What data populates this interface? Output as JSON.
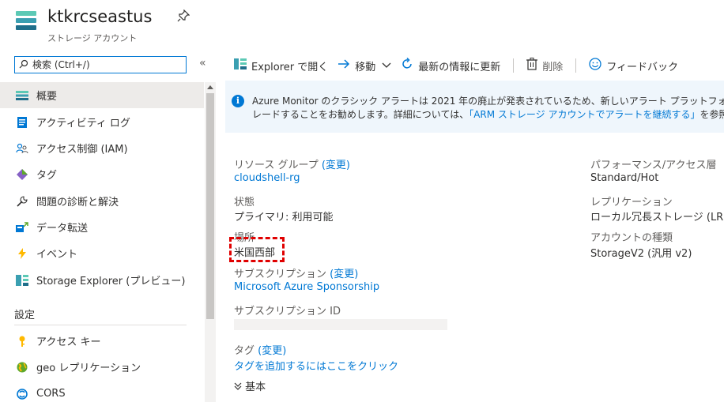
{
  "header": {
    "title": "ktkrcseastus",
    "subtitle": "ストレージ アカウント",
    "pin_icon": "pin-icon",
    "resource_icon": "storage-account-icon"
  },
  "search": {
    "placeholder": "検索 (Ctrl+/)",
    "icon": "search-icon"
  },
  "collapse_label": "«",
  "sidebar": {
    "items": [
      {
        "label": "概要",
        "icon": "overview-icon",
        "active": true
      },
      {
        "label": "アクティビティ ログ",
        "icon": "activity-log-icon"
      },
      {
        "label": "アクセス制御 (IAM)",
        "icon": "iam-icon"
      },
      {
        "label": "タグ",
        "icon": "tag-icon"
      },
      {
        "label": "問題の診断と解決",
        "icon": "wrench-icon"
      },
      {
        "label": "データ転送",
        "icon": "data-transfer-icon"
      },
      {
        "label": "イベント",
        "icon": "lightning-icon"
      },
      {
        "label": "Storage Explorer (プレビュー)",
        "icon": "storage-explorer-icon"
      }
    ],
    "section_settings": "設定",
    "settings_items": [
      {
        "label": "アクセス キー",
        "icon": "key-icon"
      },
      {
        "label": "geo レプリケーション",
        "icon": "globe-icon"
      },
      {
        "label": "CORS",
        "icon": "cors-icon"
      }
    ]
  },
  "toolbar": {
    "explorer_label": "Explorer で開く",
    "move_label": "移動",
    "refresh_label": "最新の情報に更新",
    "delete_label": "削除",
    "feedback_label": "フィードバック"
  },
  "banner": {
    "line1": "Azure Monitor のクラシック アラートは 2021 年の廃止が発表されているため、新しいアラート プラットフォームにアラート機能をアップグ",
    "line2_prefix": "レードすることをお勧めします。詳細については、",
    "line2_link": "「ARM ストレージ アカウントでアラートを継続する」",
    "line2_suffix": "を参照してください。",
    "info_glyph": "i"
  },
  "essentials": {
    "resource_group_label": "リソース グループ",
    "change_label": "(変更)",
    "resource_group_value": "cloudshell-rg",
    "status_label": "状態",
    "status_value": "プライマリ: 利用可能",
    "location_label": "場所",
    "location_value": "米国西部",
    "subscription_label": "サブスクリプション",
    "subscription_value": "Microsoft Azure Sponsorship",
    "subscription_id_label": "サブスクリプション ID",
    "tags_label": "タグ",
    "tags_value": "タグを追加するにはここをクリック",
    "performance_label": "パフォーマンス/アクセス層",
    "performance_value": "Standard/Hot",
    "replication_label": "レプリケーション",
    "replication_value": "ローカル冗長ストレージ (LRS)",
    "account_kind_label": "アカウントの種類",
    "account_kind_value": "StorageV2 (汎用 v2)",
    "expand_label": "基本"
  },
  "colors": {
    "accent": "#0078d4",
    "highlight": "#e00000",
    "banner_bg": "#eff6fc"
  }
}
